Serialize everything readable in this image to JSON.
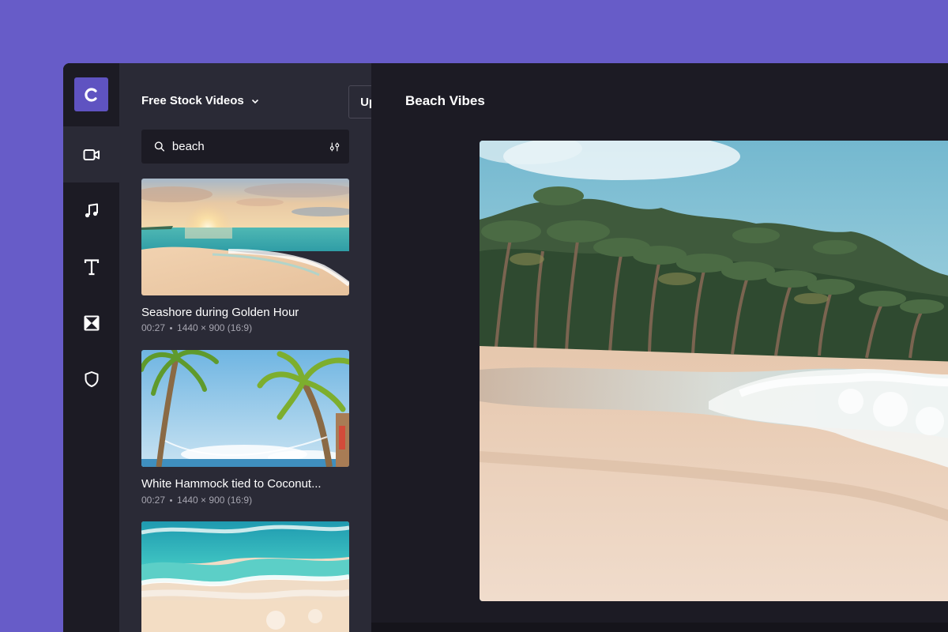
{
  "app": {
    "logo_letter": "C",
    "accent": "#5f53c1",
    "background": "#675cc8"
  },
  "rail": {
    "items": [
      {
        "icon": "video-icon",
        "active": true
      },
      {
        "icon": "music-note-icon",
        "active": false
      },
      {
        "icon": "text-icon",
        "active": false
      },
      {
        "icon": "transition-icon",
        "active": false
      },
      {
        "icon": "shield-icon",
        "active": false
      }
    ]
  },
  "panel": {
    "source_label": "Free Stock Videos",
    "upload_label": "Upload",
    "search": {
      "value": "beach",
      "placeholder": ""
    },
    "clips": [
      {
        "title": "Seashore during Golden Hour",
        "duration": "00:27",
        "resolution": "1440 × 900 (16:9)"
      },
      {
        "title": "White Hammock tied to Coconut...",
        "duration": "00:27",
        "resolution": "1440 × 900 (16:9)"
      },
      {
        "title": "",
        "duration": "",
        "resolution": ""
      }
    ]
  },
  "editor": {
    "project_title": "Beach Vibes"
  }
}
